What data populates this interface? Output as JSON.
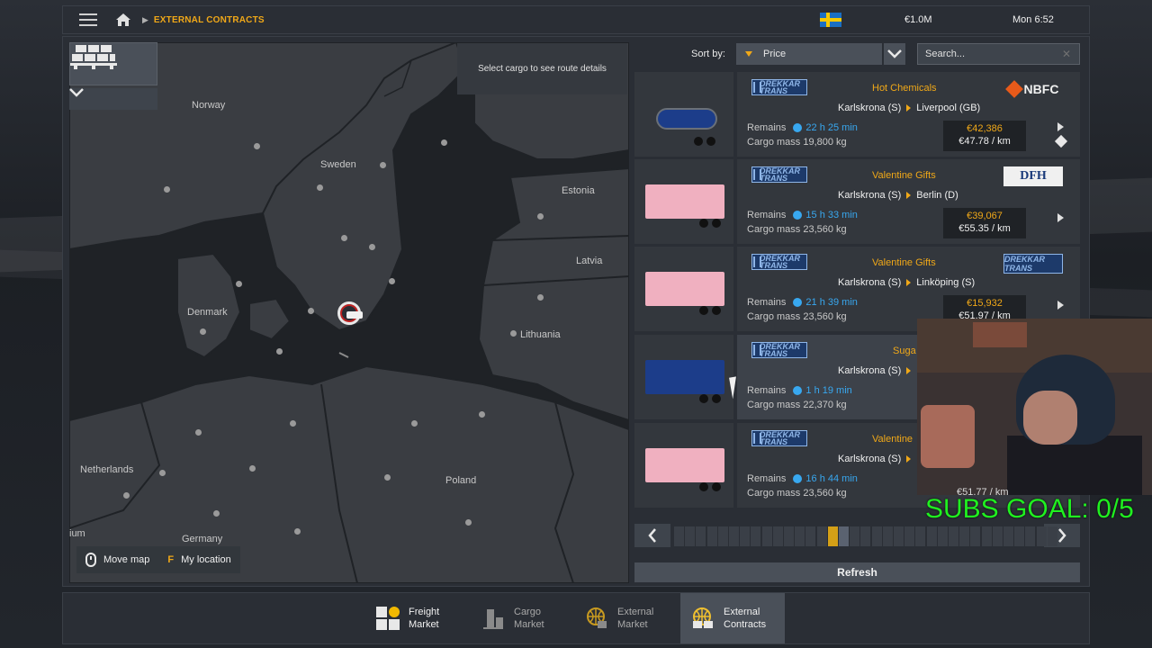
{
  "topbar": {
    "breadcrumb": "EXTERNAL CONTRACTS",
    "money": "€1.0M",
    "clock": "Mon 6:52",
    "icons": [
      "menu-icon",
      "home-icon",
      "flag-sweden-icon"
    ]
  },
  "map": {
    "route_hint": "Select cargo to see route details",
    "labels": {
      "norway": "Norway",
      "sweden": "Sweden",
      "estonia": "Estonia",
      "latvia": "Latvia",
      "denmark": "Denmark",
      "lithuania": "Lithuania",
      "netherlands": "Netherlands",
      "poland": "Poland",
      "germany": "Germany",
      "belgium_partial": "ium"
    },
    "legend": {
      "move_map": "Move map",
      "key": "F",
      "my_location": "My location"
    }
  },
  "sort": {
    "label": "Sort by:",
    "value": "Price",
    "search_placeholder": "Search..."
  },
  "jobs": [
    {
      "company": "DREKKAR TRANS",
      "cargo": "Hot Chemicals",
      "from": "Karlskrona (S)",
      "to": "Liverpool (GB)",
      "remains_label": "Remains",
      "remains": "22 h 25 min",
      "mass_label": "Cargo mass",
      "mass": "19,800 kg",
      "price": "€42,386",
      "per_km": "€47.78 / km",
      "dest_company": "NBFC"
    },
    {
      "company": "DREKKAR TRANS",
      "cargo": "Valentine Gifts",
      "from": "Karlskrona (S)",
      "to": "Berlin (D)",
      "remains_label": "Remains",
      "remains": "15 h 33 min",
      "mass_label": "Cargo mass",
      "mass": "23,560 kg",
      "price": "€39,067",
      "per_km": "€55.35 / km",
      "dest_company": "DFH"
    },
    {
      "company": "DREKKAR TRANS",
      "cargo": "Valentine Gifts",
      "from": "Karlskrona (S)",
      "to": "Linköping (S)",
      "remains_label": "Remains",
      "remains": "21 h 39 min",
      "mass_label": "Cargo mass",
      "mass": "23,560 kg",
      "price": "€15,932",
      "per_km": "€51.97 / km",
      "dest_company": "DREKKAR TRANS"
    },
    {
      "company": "DREKKAR TRANS",
      "cargo": "Suga",
      "from": "Karlskrona (S)",
      "to": "",
      "remains_label": "Remains",
      "remains": "1 h 19 min",
      "mass_label": "Cargo mass",
      "mass": "22,370 kg"
    },
    {
      "company": "DREKKAR TRANS",
      "cargo": "Valentine",
      "from": "Karlskrona (S)",
      "to": "",
      "remains_label": "Remains",
      "remains": "16 h 44 min",
      "mass_label": "Cargo mass",
      "mass": "23,560 kg",
      "per_km": "€51.77 / km"
    }
  ],
  "pager": {
    "total": 35,
    "active_index": 14
  },
  "refresh_label": "Refresh",
  "tabs": [
    {
      "line1": "Freight",
      "line2": "Market"
    },
    {
      "line1": "Cargo",
      "line2": "Market"
    },
    {
      "line1": "External",
      "line2": "Market"
    },
    {
      "line1": "External",
      "line2": "Contracts"
    }
  ],
  "overlay": {
    "subs_goal": "SUBS GOAL: 0/5"
  },
  "colors": {
    "accent": "#f0a818",
    "time": "#38a8f0",
    "subs": "#20f020"
  }
}
